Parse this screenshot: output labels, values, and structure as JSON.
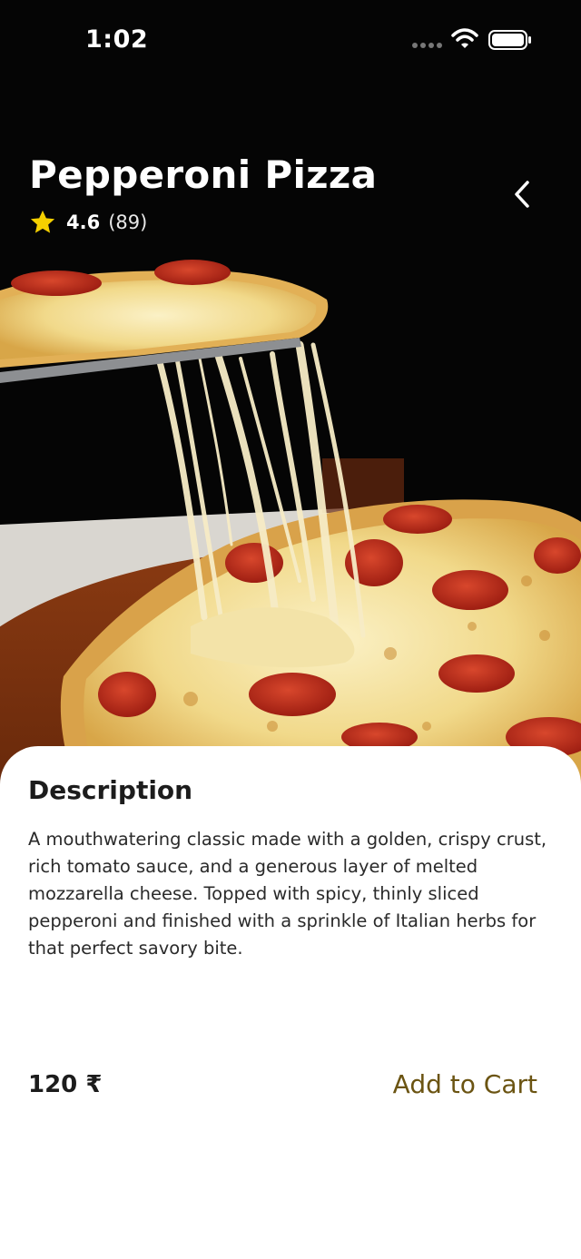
{
  "status_bar": {
    "time": "1:02",
    "icons": [
      "signal-icon",
      "wifi-icon",
      "battery-icon"
    ]
  },
  "product": {
    "name": "Pepperoni Pizza",
    "rating": "4.6",
    "rating_count": "(89)",
    "image": "pepperoni-pizza-photo",
    "back_icon": "chevron-left-icon"
  },
  "details": {
    "heading": "Description",
    "text": "A mouthwatering classic made with a golden, crispy crust, rich tomato sauce, and a generous layer of melted mozzarella cheese. Topped with spicy, thinly sliced pepperoni and finished with a sprinkle of Italian herbs for that perfect savory bite.",
    "price": "120 ₹",
    "cta_label": "Add to Cart"
  },
  "colors": {
    "accent": "#6b5412",
    "star": "#f5d000",
    "hero_bg": "#050505",
    "sheet_bg": "#ffffff"
  }
}
